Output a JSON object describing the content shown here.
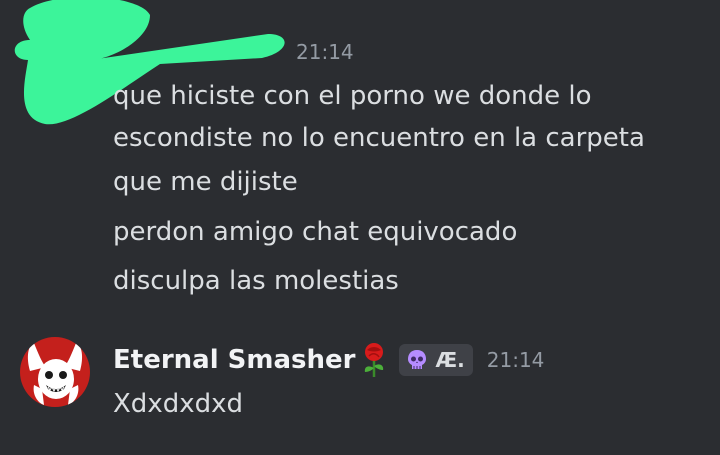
{
  "messages": {
    "first": {
      "timestamp": "21:14",
      "lines": [
        "que hiciste con el porno we donde lo",
        "escondiste no lo encuentro en la carpeta",
        "que me dijiste",
        "perdon amigo chat equivocado",
        "disculpa las molestias"
      ]
    },
    "second": {
      "author": "Eternal Smasher",
      "tag": "Æ.",
      "timestamp": "21:14",
      "text": "Xdxdxdxd"
    }
  },
  "icons": {
    "redaction": "green-scribble",
    "author_emoji": "rose-icon",
    "tag_emoji": "skull-icon"
  },
  "colors": {
    "background": "#2b2d31",
    "redaction": "#3cf49a",
    "avatar_red": "#c4201c"
  }
}
